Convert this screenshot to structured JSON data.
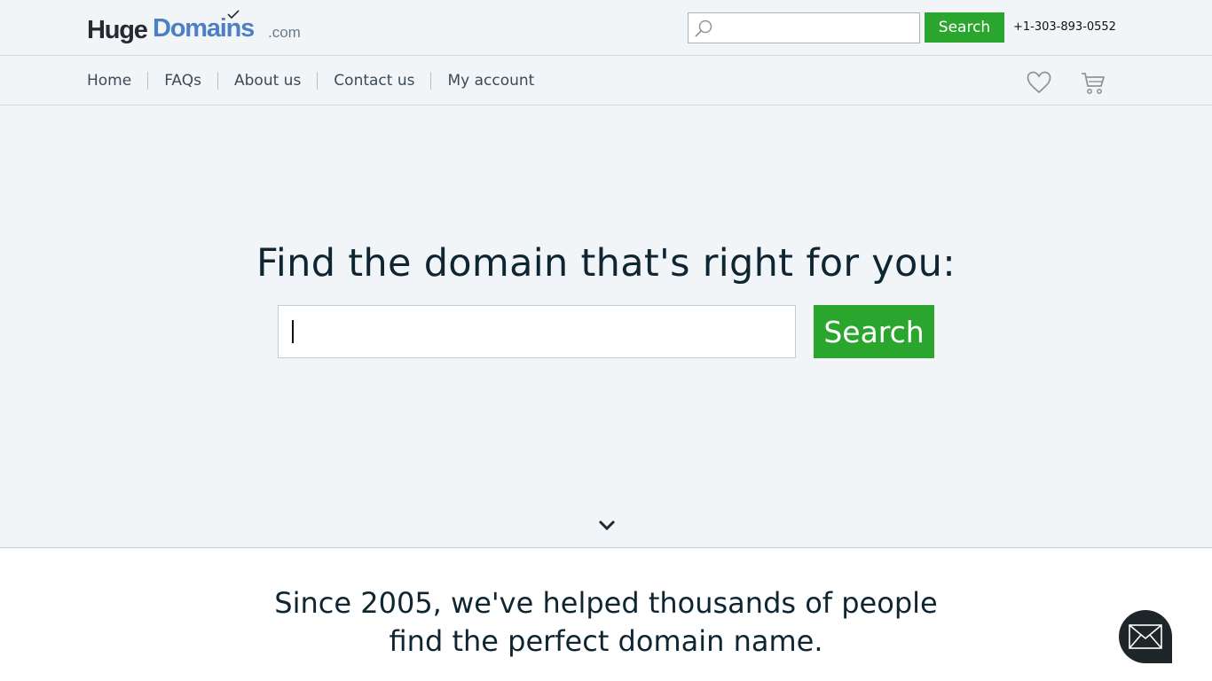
{
  "header": {
    "logo": {
      "part1": "Huge",
      "part2": "Domains",
      "suffix": ".com"
    },
    "search": {
      "placeholder": "",
      "button_label": "Search"
    },
    "phone": "+1-303-893-0552"
  },
  "nav": {
    "items": [
      {
        "label": "Home"
      },
      {
        "label": "FAQs"
      },
      {
        "label": "About us"
      },
      {
        "label": "Contact us"
      },
      {
        "label": "My account"
      }
    ],
    "icons": [
      "heart-icon",
      "cart-icon"
    ]
  },
  "hero": {
    "title": "Find the domain that's right for you:",
    "search_placeholder": "",
    "search_button": "Search"
  },
  "lower": {
    "tagline_line1": "Since 2005, we've helped thousands of people",
    "tagline_line2": "find the perfect domain name."
  },
  "colors": {
    "accent_green": "#2aa62e",
    "brand_blue": "#4d80c2",
    "background": "#f2f5f8",
    "text_dark": "#0f2532"
  }
}
